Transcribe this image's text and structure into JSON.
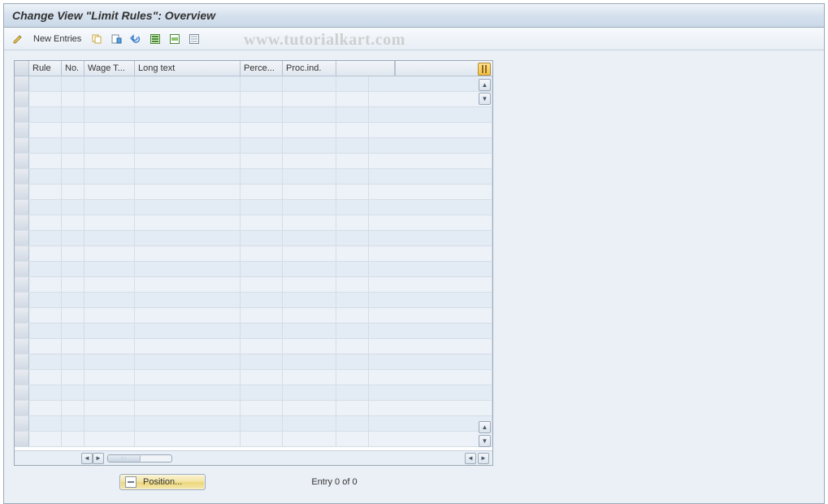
{
  "header": {
    "title": "Change View \"Limit Rules\": Overview"
  },
  "watermark": "www.tutorialkart.com",
  "toolbar": {
    "new_entries_label": "New Entries",
    "icons": {
      "edit": "edit-icon",
      "copy": "copy-icon",
      "delete": "delete-icon",
      "undo": "undo-icon",
      "select_all": "select-all-icon",
      "select_block": "select-block-icon",
      "deselect_all": "deselect-all-icon"
    }
  },
  "grid": {
    "columns": [
      {
        "key": "rule",
        "label": "Rule"
      },
      {
        "key": "no",
        "label": "No."
      },
      {
        "key": "wage",
        "label": "Wage T..."
      },
      {
        "key": "long",
        "label": "Long text"
      },
      {
        "key": "perce",
        "label": "Perce..."
      },
      {
        "key": "proc",
        "label": "Proc.ind."
      },
      {
        "key": "last",
        "label": ""
      }
    ],
    "row_count": 24,
    "rows": []
  },
  "footer": {
    "position_label": "Position...",
    "entry_text": "Entry 0 of 0"
  },
  "colors": {
    "header_gradient_top": "#eef3f8",
    "header_gradient_bottom": "#cad8e8",
    "border": "#9aa9b8",
    "row_even": "#edf2f8",
    "row_odd": "#e3ebf4"
  }
}
